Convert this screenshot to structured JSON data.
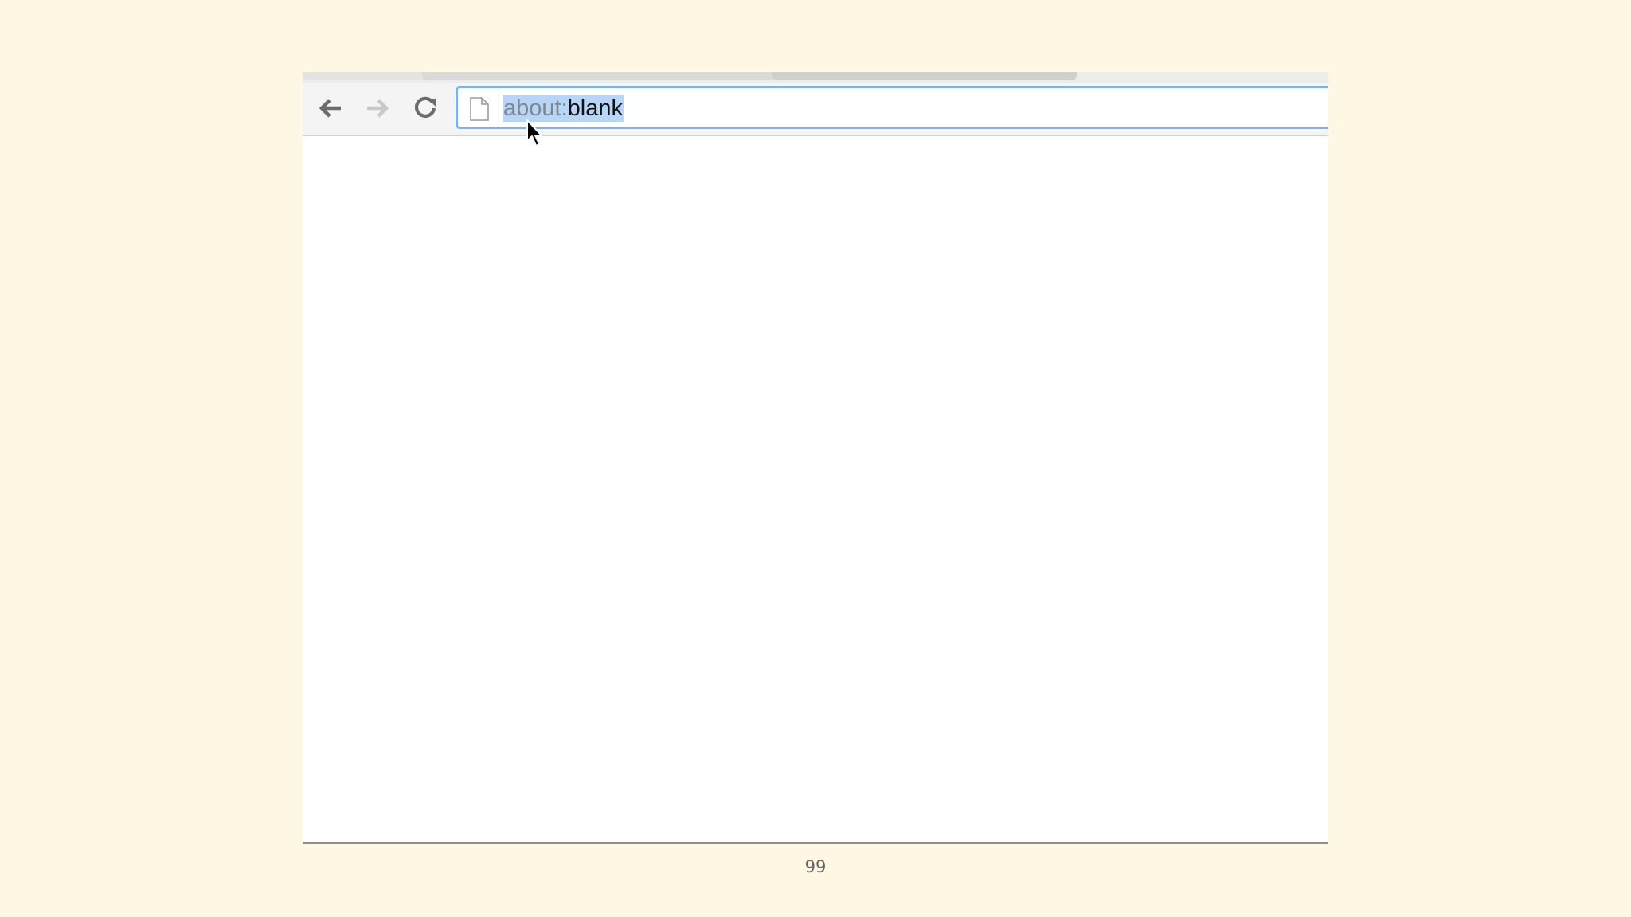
{
  "browser": {
    "address_bar": {
      "url_scheme": "about:",
      "url_host": "blank"
    },
    "icons": {
      "back": "back-arrow-icon",
      "forward": "forward-arrow-icon",
      "reload": "reload-icon",
      "page": "page-icon",
      "cursor": "mouse-cursor-icon"
    }
  },
  "slide": {
    "page_number": "99"
  },
  "colors": {
    "slide_background": "#fdf7e3",
    "selection_highlight": "#b7d5f6",
    "omnibox_focus_border": "#7fb1ef"
  }
}
